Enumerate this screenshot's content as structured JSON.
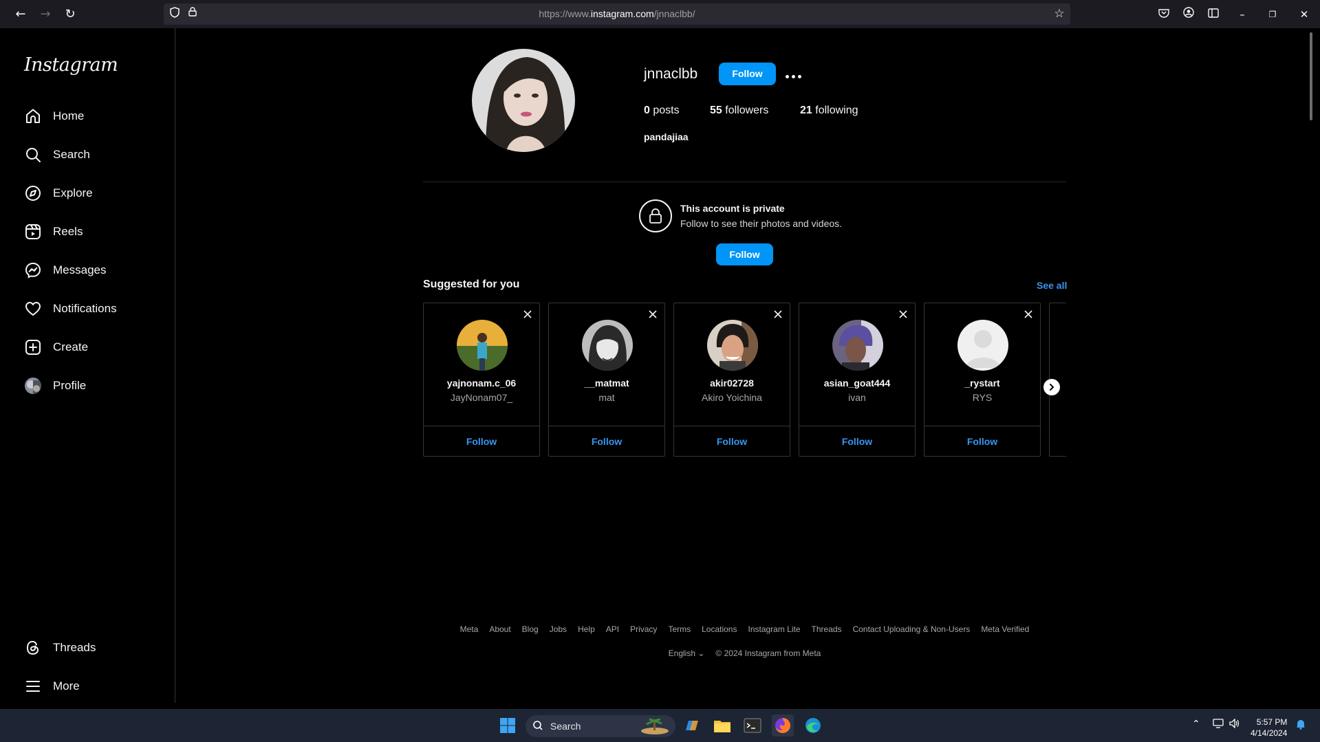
{
  "browser": {
    "url_prefix": "https://www.",
    "url_domain": "instagram.com",
    "url_path": "/jnnaclbb/",
    "back_icon": "arrow-left-icon",
    "forward_icon": "arrow-right-icon",
    "reload_icon": "reload-icon"
  },
  "sidebar": {
    "logo": "Instagram",
    "items": [
      {
        "label": "Home",
        "icon": "home-icon"
      },
      {
        "label": "Search",
        "icon": "search-icon"
      },
      {
        "label": "Explore",
        "icon": "compass-icon"
      },
      {
        "label": "Reels",
        "icon": "reels-icon"
      },
      {
        "label": "Messages",
        "icon": "messenger-icon"
      },
      {
        "label": "Notifications",
        "icon": "heart-icon"
      },
      {
        "label": "Create",
        "icon": "plus-square-icon"
      },
      {
        "label": "Profile",
        "icon": "avatar"
      }
    ],
    "bottom_items": [
      {
        "label": "Threads",
        "icon": "threads-icon"
      },
      {
        "label": "More",
        "icon": "menu-icon"
      }
    ]
  },
  "profile": {
    "username": "jnnaclbb",
    "follow_label": "Follow",
    "posts_count": "0",
    "posts_label": "posts",
    "followers_count": "55",
    "followers_label": "followers",
    "following_count": "21",
    "following_label": "following",
    "full_name": "pandajiaa"
  },
  "private": {
    "title": "This account is private",
    "subtitle": "Follow to see their photos and videos.",
    "follow_label": "Follow"
  },
  "suggested": {
    "title": "Suggested for you",
    "see_all": "See all",
    "cards": [
      {
        "username": "yajnonam.c_06",
        "name": "JayNonam07_",
        "follow": "Follow"
      },
      {
        "username": "__matmat",
        "name": "mat",
        "follow": "Follow"
      },
      {
        "username": "akir02728",
        "name": "Akiro Yoichina",
        "follow": "Follow"
      },
      {
        "username": "asian_goat444",
        "name": "ivan",
        "follow": "Follow"
      },
      {
        "username": "_rystart",
        "name": "RYS",
        "follow": "Follow"
      }
    ]
  },
  "footer": {
    "links": [
      "Meta",
      "About",
      "Blog",
      "Jobs",
      "Help",
      "API",
      "Privacy",
      "Terms",
      "Locations",
      "Instagram Lite",
      "Threads",
      "Contact Uploading & Non-Users",
      "Meta Verified"
    ],
    "language": "English",
    "copyright": "© 2024 Instagram from Meta"
  },
  "taskbar": {
    "search_label": "Search",
    "time": "5:57 PM",
    "date": "4/14/2024"
  },
  "colors": {
    "accent": "#0095f6",
    "link": "#3896f0",
    "background": "#000000",
    "border": "#363636"
  }
}
